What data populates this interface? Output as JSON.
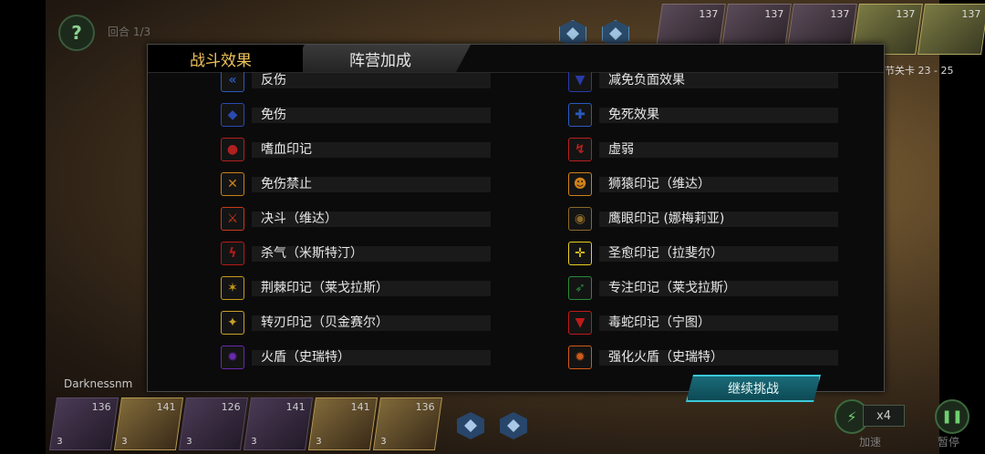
{
  "hud": {
    "help_symbol": "?",
    "round_text": "回合 1/3",
    "stage_text": "节关卡 23 - 25",
    "enemy_levels": [
      "137",
      "137",
      "137",
      "137",
      "137"
    ],
    "player_name": "Darknessnm",
    "hero_levels": [
      "136",
      "141",
      "126",
      "141",
      "141",
      "136"
    ],
    "hero_ranks": [
      "3",
      "3",
      "3",
      "3",
      "3",
      "3"
    ],
    "speed_value": "x4",
    "speed_label": "加速",
    "pause_label": "暂停"
  },
  "modal": {
    "tabs": [
      {
        "label": "战斗效果",
        "active": true
      },
      {
        "label": "阵营加成",
        "active": false
      }
    ],
    "left_effects": [
      {
        "label": "反伤",
        "icon": "reflect-icon",
        "color": "#2a5ab8"
      },
      {
        "label": "免伤",
        "icon": "shield-icon",
        "color": "#2a4ab0"
      },
      {
        "label": "嗜血印记",
        "icon": "blood-drop-icon",
        "color": "#b02020"
      },
      {
        "label": "免伤禁止",
        "icon": "crossed-swords-icon",
        "color": "#c8801a"
      },
      {
        "label": "决斗（维达）",
        "icon": "duel-icon",
        "color": "#c83a1a"
      },
      {
        "label": "杀气（米斯特汀）",
        "icon": "killing-aura-icon",
        "color": "#b81a1a"
      },
      {
        "label": "荆棘印记（莱戈拉斯）",
        "icon": "thorns-icon",
        "color": "#c89a1a"
      },
      {
        "label": "转刃印记（贝金赛尔）",
        "icon": "spin-blade-icon",
        "color": "#c8a02a"
      },
      {
        "label": "火盾（史瑞特）",
        "icon": "fire-shield-icon",
        "color": "#6a2ab0"
      }
    ],
    "right_effects": [
      {
        "label": "减免负面效果",
        "icon": "debuff-reduce-icon",
        "color": "#2a3aa8"
      },
      {
        "label": "免死效果",
        "icon": "cross-shield-icon",
        "color": "#2a5ac0"
      },
      {
        "label": "虚弱",
        "icon": "weakness-icon",
        "color": "#b82020"
      },
      {
        "label": "狮猿印记（维达）",
        "icon": "lion-ape-icon",
        "color": "#d0801a"
      },
      {
        "label": "鹰眼印记 (娜梅莉亚)",
        "icon": "eagle-eye-icon",
        "color": "#8a6a2a"
      },
      {
        "label": "圣愈印记（拉斐尔）",
        "icon": "holy-cross-icon",
        "color": "#e8d020"
      },
      {
        "label": "专注印记（莱戈拉斯）",
        "icon": "focus-arrow-icon",
        "color": "#2a8a3a"
      },
      {
        "label": "毒蛇印记（宁图）",
        "icon": "viper-icon",
        "color": "#c01a1a"
      },
      {
        "label": "强化火盾（史瑞特）",
        "icon": "enhanced-fire-shield-icon",
        "color": "#d05a1a"
      }
    ]
  },
  "continue_label": "继续挑战"
}
